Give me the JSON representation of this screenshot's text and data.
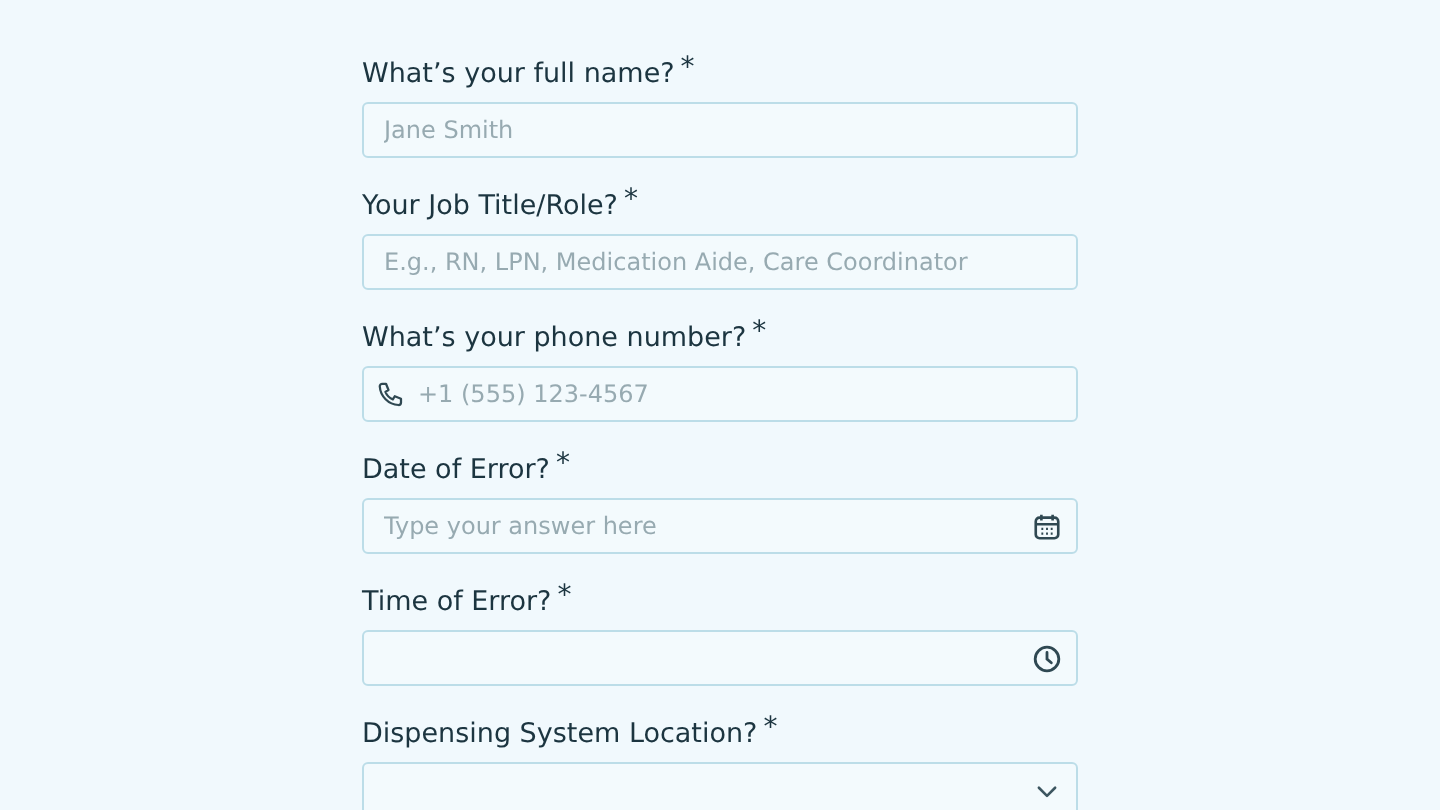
{
  "fields": [
    {
      "label": "What’s your full name?",
      "required_mark": "*",
      "kind": "text",
      "placeholder": "Jane Smith"
    },
    {
      "label": "Your Job Title/Role?",
      "required_mark": "*",
      "kind": "text",
      "placeholder": "E.g., RN, LPN, Medication Aide, Care Coordinator"
    },
    {
      "label": "What’s your phone number?",
      "required_mark": "*",
      "kind": "phone",
      "placeholder": "+1 (555) 123-4567"
    },
    {
      "label": "Date of Error?",
      "required_mark": "*",
      "kind": "date",
      "placeholder": "Type your answer here"
    },
    {
      "label": "Time of Error?",
      "required_mark": "*",
      "kind": "time"
    },
    {
      "label": "Dispensing System Location?",
      "required_mark": "*",
      "kind": "select"
    }
  ]
}
